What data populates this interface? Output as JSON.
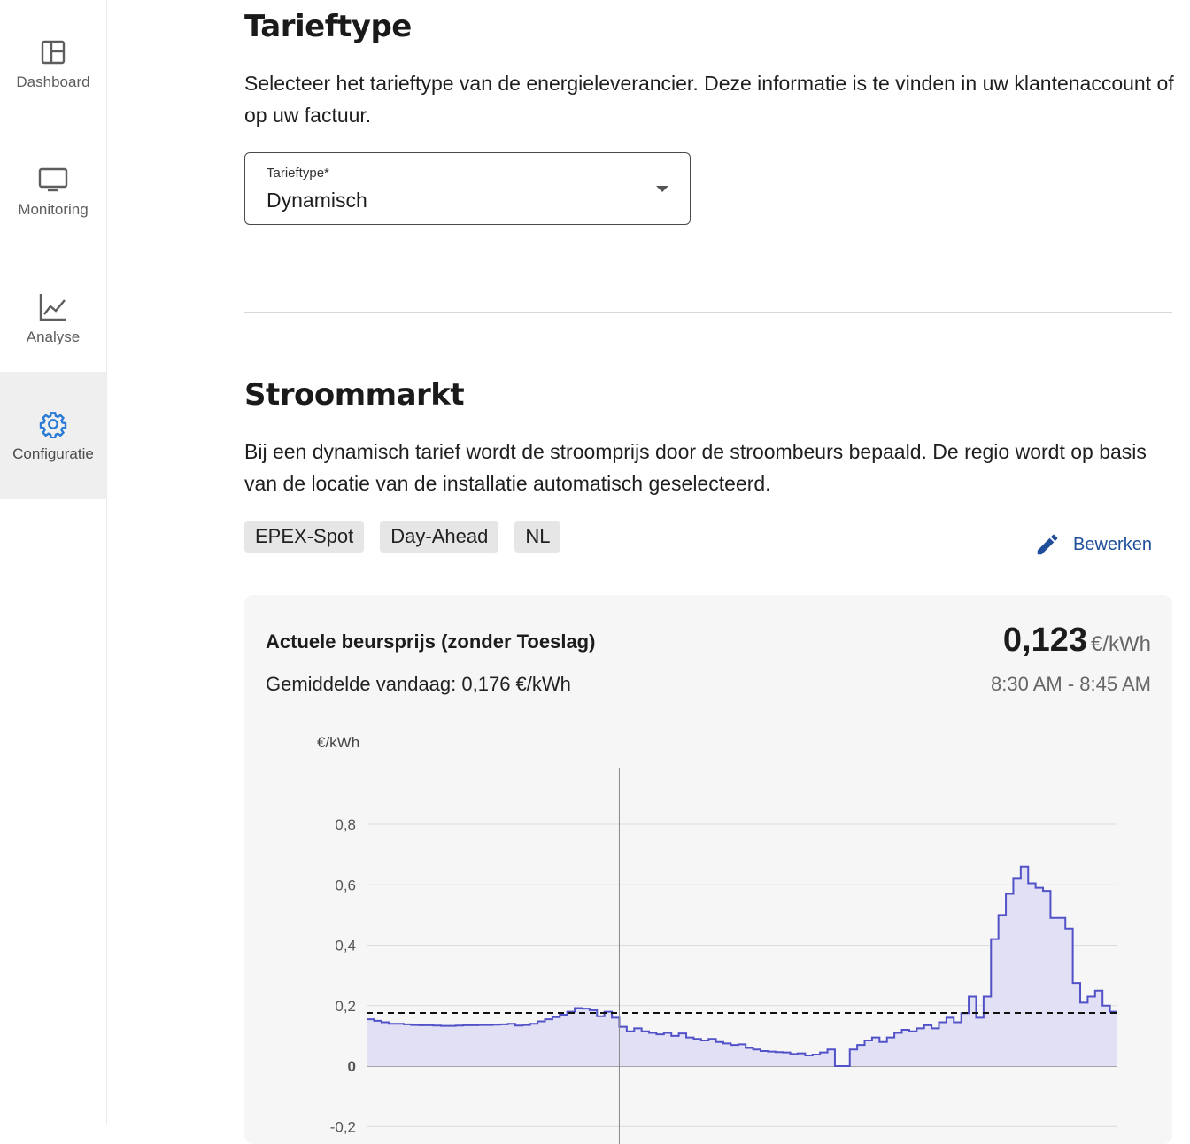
{
  "sidebar": {
    "items": [
      {
        "label": "Dashboard",
        "icon": "dashboard-icon"
      },
      {
        "label": "Monitoring",
        "icon": "monitor-icon"
      },
      {
        "label": "Analyse",
        "icon": "chart-line-icon"
      },
      {
        "label": "Configuratie",
        "icon": "gear-icon",
        "active": true
      }
    ]
  },
  "tarief": {
    "title": "Tarieftype",
    "description": "Selecteer het tarieftype van de energieleverancier. Deze informatie is te vinden in uw klantenaccount of op uw factuur.",
    "select_label": "Tarieftype*",
    "select_value": "Dynamisch"
  },
  "market": {
    "title": "Stroommarkt",
    "description": "Bij een dynamisch tarief wordt de stroomprijs door de stroombeurs bepaald. De regio wordt op basis van de locatie van de installatie automatisch geselecteerd.",
    "chips": [
      "EPEX-Spot",
      "Day-Ahead",
      "NL"
    ],
    "edit_label": "Bewerken"
  },
  "price_card": {
    "title": "Actuele beursprijs (zonder Toeslag)",
    "average": "Gemiddelde vandaag: 0,176 €/kWh",
    "current_value": "0,123",
    "current_unit": "€/kWh",
    "current_time": "8:30 AM - 8:45 AM"
  },
  "colors": {
    "accent": "#2b7bd6",
    "link": "#1f4e9a",
    "series_line": "#5252c8",
    "series_fill": "#e2e0f5"
  },
  "chart_data": {
    "type": "area",
    "ylabel": "€/kWh",
    "y_ticks": [
      "0,8",
      "0,6",
      "0,4",
      "0,2",
      "0",
      "-0,2"
    ],
    "ylim": [
      -0.2,
      0.8
    ],
    "average_line": 0.176,
    "current_marker_index": 34,
    "grid": true,
    "values": [
      0.155,
      0.15,
      0.145,
      0.14,
      0.14,
      0.138,
      0.136,
      0.135,
      0.135,
      0.134,
      0.133,
      0.133,
      0.134,
      0.135,
      0.135,
      0.136,
      0.136,
      0.137,
      0.138,
      0.14,
      0.134,
      0.136,
      0.14,
      0.148,
      0.155,
      0.162,
      0.17,
      0.18,
      0.192,
      0.19,
      0.185,
      0.165,
      0.18,
      0.16,
      0.13,
      0.115,
      0.125,
      0.115,
      0.11,
      0.105,
      0.11,
      0.1,
      0.108,
      0.095,
      0.09,
      0.085,
      0.09,
      0.08,
      0.075,
      0.07,
      0.072,
      0.06,
      0.055,
      0.05,
      0.048,
      0.046,
      0.045,
      0.04,
      0.042,
      0.035,
      0.038,
      0.045,
      0.055,
      0.0,
      0.0,
      0.055,
      0.07,
      0.085,
      0.095,
      0.08,
      0.095,
      0.11,
      0.12,
      0.115,
      0.125,
      0.135,
      0.125,
      0.145,
      0.16,
      0.145,
      0.175,
      0.23,
      0.16,
      0.23,
      0.42,
      0.5,
      0.57,
      0.62,
      0.66,
      0.605,
      0.59,
      0.58,
      0.49,
      0.49,
      0.455,
      0.275,
      0.21,
      0.23,
      0.25,
      0.2,
      0.18
    ]
  }
}
